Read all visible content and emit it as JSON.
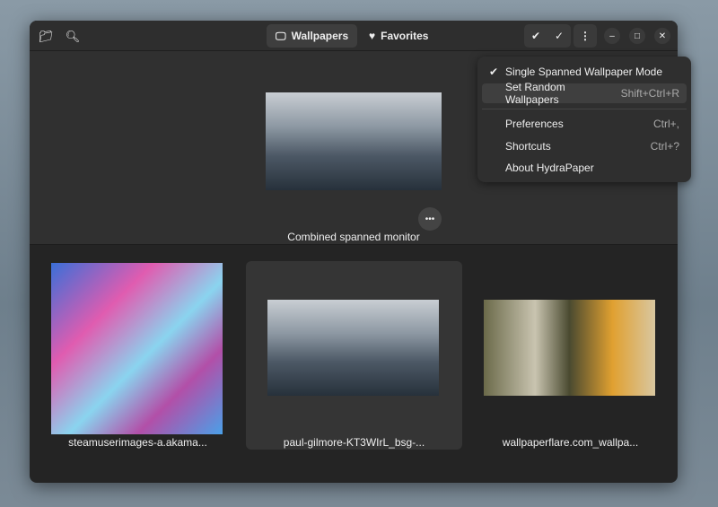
{
  "header": {
    "tabs": [
      {
        "label": "Wallpapers",
        "icon": "monitor-icon",
        "active": true
      },
      {
        "label": "Favorites",
        "icon": "heart-icon",
        "active": false
      }
    ]
  },
  "spanned": {
    "caption": "Combined spanned monitor"
  },
  "wallpapers": [
    {
      "name": "steamuserimages-a.akama..."
    },
    {
      "name": "paul-gilmore-KT3WIrL_bsg-...",
      "selected": true
    },
    {
      "name": "wallpaperflare.com_wallpa..."
    }
  ],
  "menu": {
    "items": [
      {
        "label": "Single Spanned Wallpaper Mode",
        "checked": true,
        "shortcut": ""
      },
      {
        "label": "Set Random Wallpapers",
        "shortcut": "Shift+Ctrl+R"
      },
      {
        "label": "Preferences",
        "shortcut": "Ctrl+,"
      },
      {
        "label": "Shortcuts",
        "shortcut": "Ctrl+?"
      },
      {
        "label": "About HydraPaper",
        "shortcut": ""
      }
    ]
  }
}
